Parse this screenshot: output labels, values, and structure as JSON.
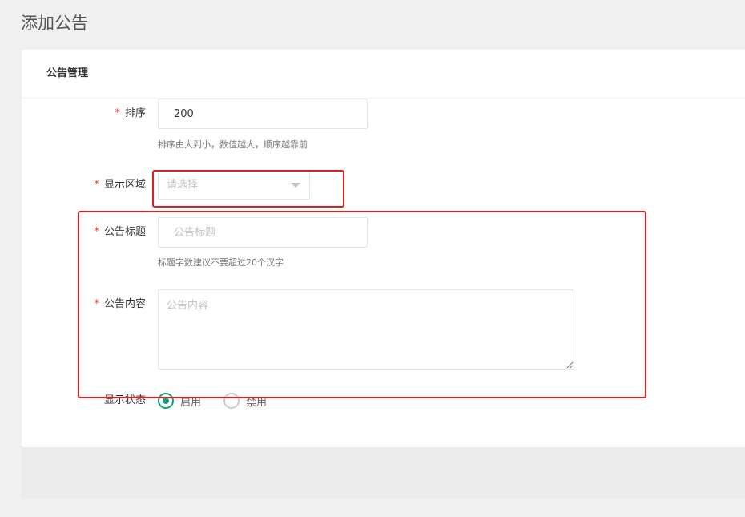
{
  "page": {
    "title": "添加公告"
  },
  "card": {
    "header_title": "公告管理"
  },
  "form": {
    "sort": {
      "label": "排序",
      "value": "200",
      "hint": "排序由大到小，数值越大，顺序越靠前"
    },
    "region": {
      "label": "显示区域",
      "placeholder": "请选择"
    },
    "title": {
      "label": "公告标题",
      "placeholder": "公告标题",
      "hint": "标题字数建议不要超过20个汉字"
    },
    "content": {
      "label": "公告内容",
      "placeholder": "公告内容"
    },
    "status": {
      "label": "显示状态",
      "options": [
        "启用",
        "禁用"
      ],
      "selected": "启用"
    },
    "required_mark": "*"
  },
  "colors": {
    "accent": "#16a085",
    "required": "#e4393c",
    "highlight": "#e02020"
  }
}
